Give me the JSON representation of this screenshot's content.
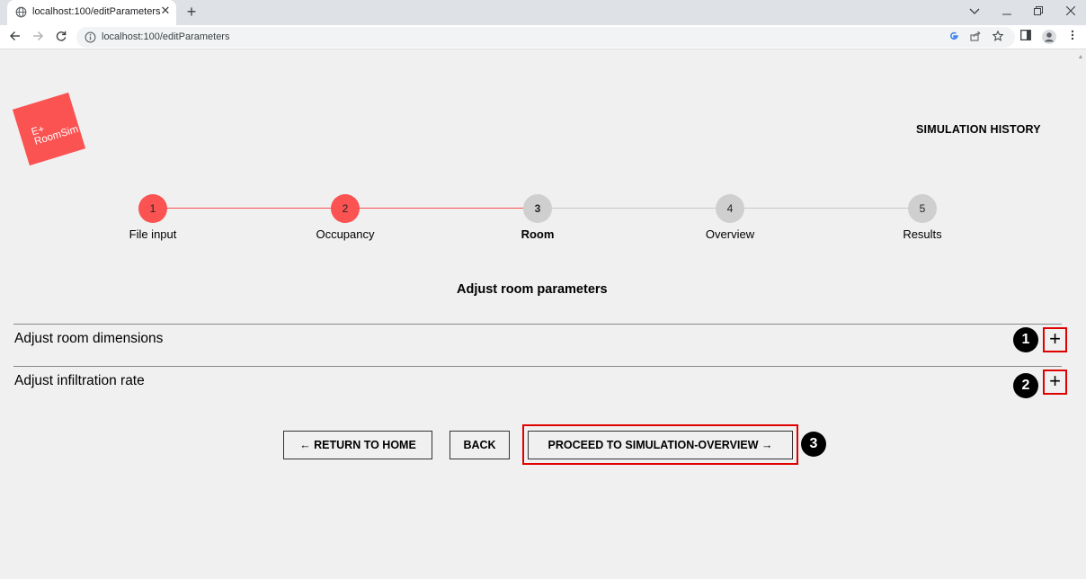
{
  "browser": {
    "tab_title": "localhost:100/editParameters",
    "url": "localhost:100/editParameters",
    "new_tab": "+",
    "close_tab": "✕"
  },
  "app": {
    "logo_text_line1": "E+",
    "logo_text_line2": "RoomSim",
    "simulation_history": "SIMULATION HISTORY",
    "accent_color": "#fb5252"
  },
  "stepper": {
    "steps": [
      {
        "number": "1",
        "label": "File input",
        "state": "done"
      },
      {
        "number": "2",
        "label": "Occupancy",
        "state": "done"
      },
      {
        "number": "3",
        "label": "Room",
        "state": "active"
      },
      {
        "number": "4",
        "label": "Overview",
        "state": "todo"
      },
      {
        "number": "5",
        "label": "Results",
        "state": "todo"
      }
    ]
  },
  "main": {
    "title": "Adjust room parameters",
    "accordions": [
      {
        "label": "Adjust room dimensions",
        "expand_symbol": "+",
        "marker": "1"
      },
      {
        "label": "Adjust infiltration rate",
        "expand_symbol": "+",
        "marker": "2"
      }
    ],
    "buttons": {
      "return_home": "← RETURN TO HOME",
      "back": "BACK",
      "proceed": "PROCEED TO SIMULATION-OVERVIEW →",
      "proceed_marker": "3"
    }
  }
}
